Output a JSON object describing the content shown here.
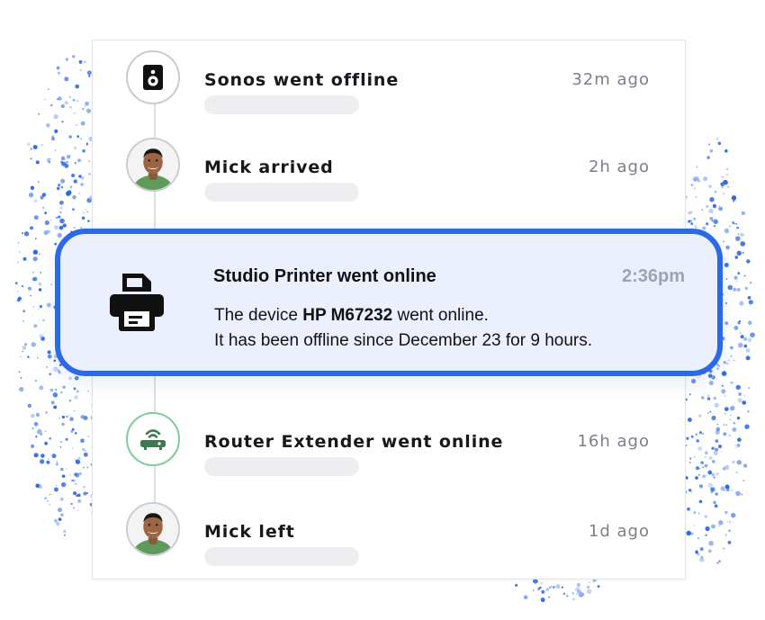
{
  "events": [
    {
      "title": "Sonos went offline",
      "time": "32m ago",
      "icon": "speaker-icon"
    },
    {
      "title": "Mick arrived",
      "time": "2h ago",
      "icon": "avatar"
    },
    {
      "title": "Router Extender went online",
      "time": "16h ago",
      "icon": "router-icon"
    },
    {
      "title": "Mick left",
      "time": "1d ago",
      "icon": "avatar"
    }
  ],
  "highlight": {
    "title": "Studio Printer went online",
    "time": "2:36pm",
    "icon": "printer-icon",
    "message_prefix": "The device ",
    "device": "HP M67232",
    "message_suffix": " went online.",
    "message_line2": "It has been offline since December 23 for 9 hours."
  },
  "colors": {
    "accent": "#2a6ae6",
    "highlight_bg": "#eceffd",
    "router_badge": "#3d7a4f",
    "timestamp": "#7c7f86"
  }
}
